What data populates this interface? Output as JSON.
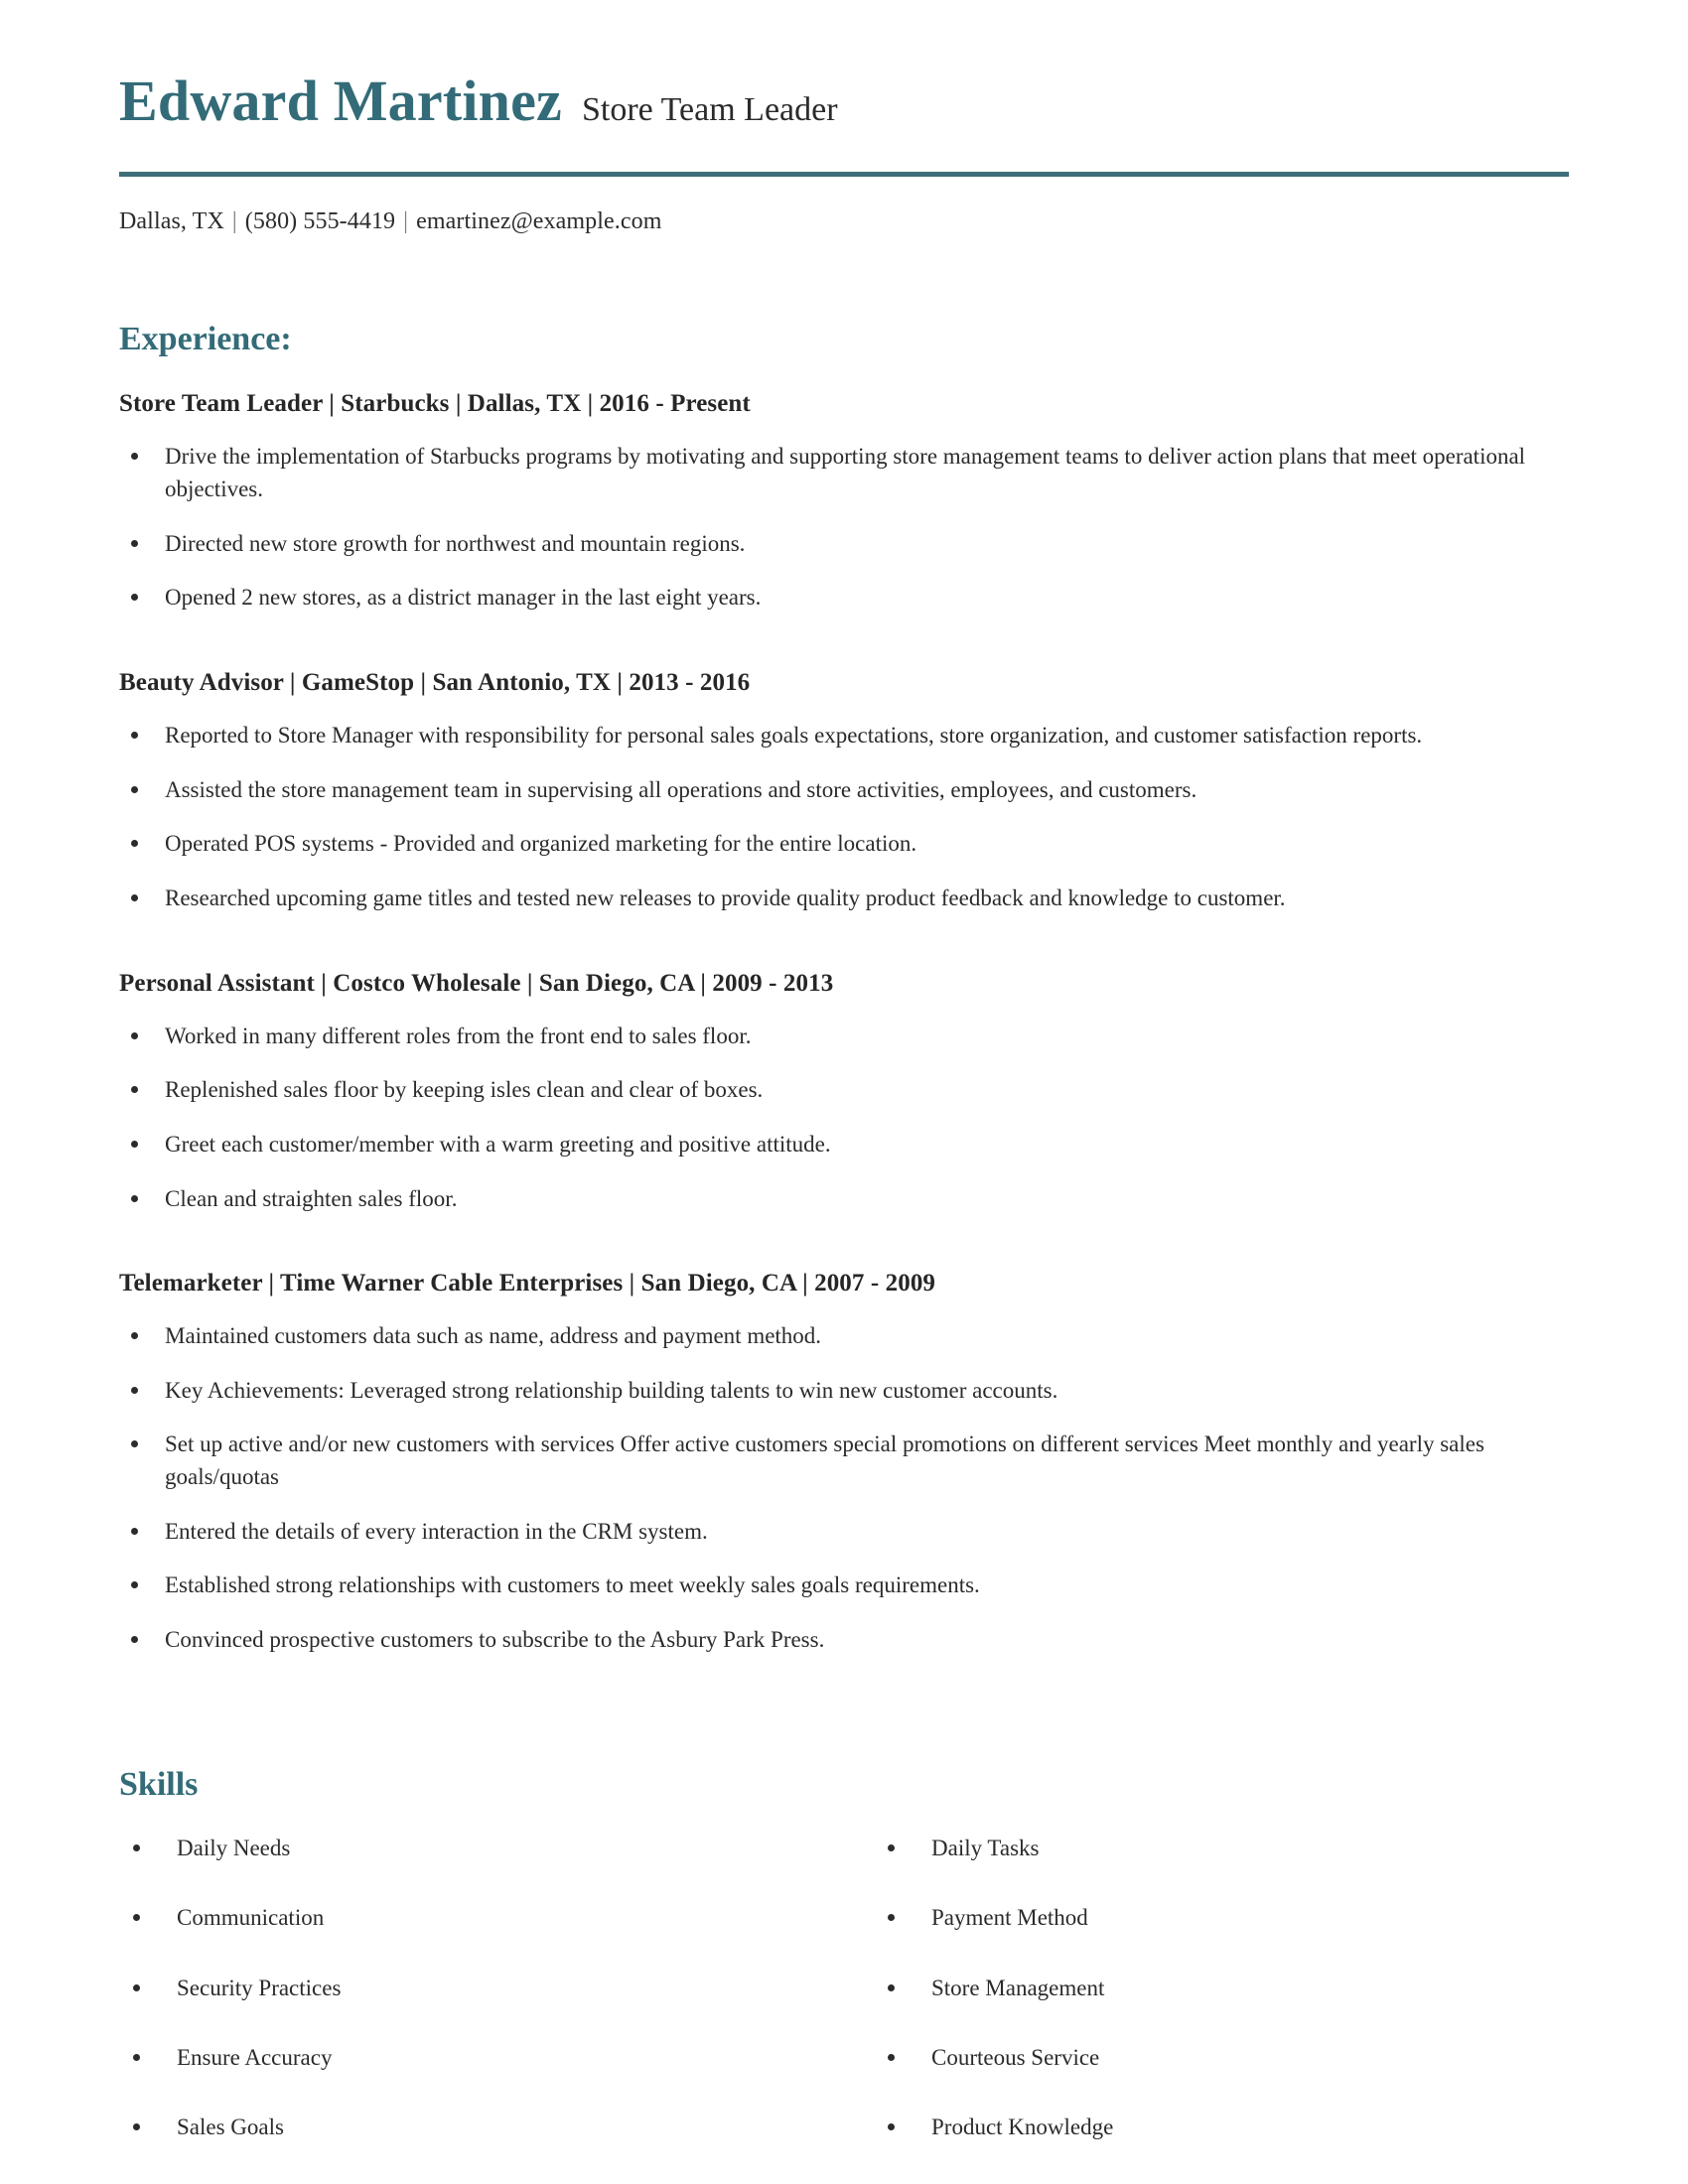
{
  "theme": {
    "accent_color": "#336b78",
    "rule_color": "#3d6e79",
    "text_color": "#2b2b2b",
    "background_color": "#ffffff"
  },
  "header": {
    "full_name": "Edward Martinez",
    "job_title": "Store Team Leader",
    "contact": {
      "location": "Dallas, TX",
      "phone": "(580) 555-4419",
      "email": "emartinez@example.com",
      "separator": "|"
    }
  },
  "experience": {
    "heading": "Experience:",
    "jobs": [
      {
        "heading": "Store Team Leader | Starbucks | Dallas, TX | 2016 - Present",
        "title": "Store Team Leader",
        "company": "Starbucks",
        "location": "Dallas, TX",
        "dates": "2016 - Present",
        "bullets": [
          "Drive the implementation of Starbucks programs by motivating and supporting store management teams to deliver action plans that meet operational objectives.",
          "Directed new store growth for northwest and mountain regions.",
          "Opened 2 new stores, as a district manager in the last eight years."
        ]
      },
      {
        "heading": "Beauty Advisor | GameStop | San Antonio, TX | 2013 - 2016",
        "title": "Beauty Advisor",
        "company": "GameStop",
        "location": "San Antonio, TX",
        "dates": "2013 - 2016",
        "bullets": [
          "Reported to Store Manager with responsibility for personal sales goals expectations, store organization, and customer satisfaction reports.",
          "Assisted the store management team in supervising all operations and store activities, employees, and customers.",
          "Operated POS systems - Provided and organized marketing for the entire location.",
          "Researched upcoming game titles and tested new releases to provide quality product feedback and knowledge to customer."
        ]
      },
      {
        "heading": "Personal Assistant | Costco Wholesale | San Diego, CA | 2009 - 2013",
        "title": "Personal Assistant",
        "company": "Costco Wholesale",
        "location": "San Diego, CA",
        "dates": "2009 - 2013",
        "bullets": [
          "Worked in many different roles from the front end to sales floor.",
          "Replenished sales floor by keeping isles clean and clear of boxes.",
          "Greet each customer/member with a warm greeting and positive attitude.",
          "Clean and straighten sales floor."
        ]
      },
      {
        "heading": "Telemarketer | Time Warner Cable Enterprises | San Diego, CA | 2007 - 2009",
        "title": "Telemarketer",
        "company": "Time Warner Cable Enterprises",
        "location": "San Diego, CA",
        "dates": "2007 - 2009",
        "bullets": [
          "Maintained customers data such as name, address and payment method.",
          "Key Achievements: Leveraged strong relationship building talents to win new customer accounts.",
          "Set up active and/or new customers with services Offer active customers special promotions on different services Meet monthly and yearly sales goals/quotas",
          "Entered the details of every interaction in the CRM system.",
          "Established strong relationships with customers to meet weekly sales goals requirements.",
          "Convinced prospective customers to subscribe to the Asbury Park Press."
        ]
      }
    ]
  },
  "skills": {
    "heading": "Skills",
    "left_column": [
      "Daily Needs",
      "Communication",
      "Security Practices",
      "Ensure Accuracy",
      "Sales Goals"
    ],
    "right_column": [
      "Daily Tasks",
      "Payment Method",
      "Store Management",
      "Courteous Service",
      "Product Knowledge"
    ]
  }
}
